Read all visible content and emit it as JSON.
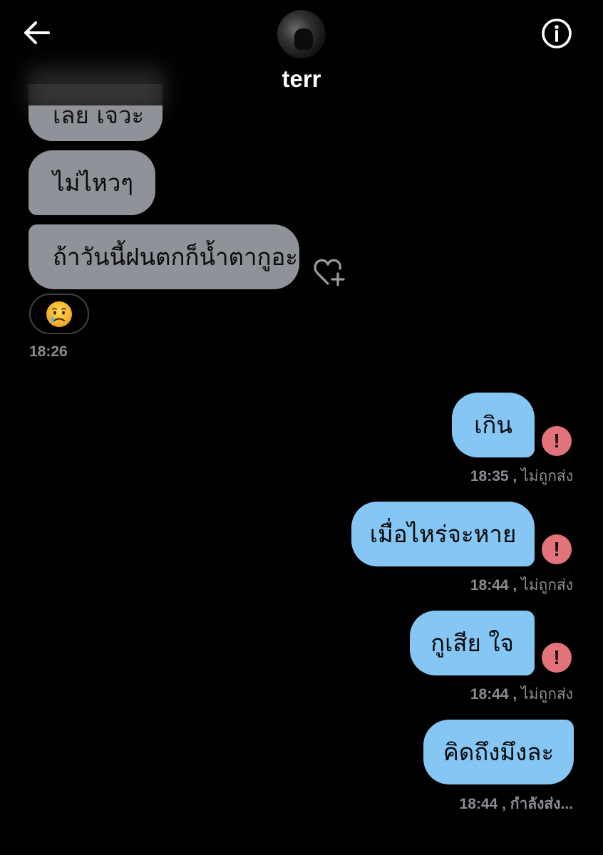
{
  "header": {
    "contact_name": "terr",
    "back_icon": "arrow-left-icon",
    "info_icon": "info-icon"
  },
  "incoming": [
    {
      "text": "เลย เจวะ"
    },
    {
      "text": "ไม่ไหวๆ"
    },
    {
      "text": "ถ้าวันนี้ฝนตกก็น้ำตากูอะ"
    }
  ],
  "reaction": {
    "emoji": "😢"
  },
  "incoming_time": "18:26",
  "outgoing": [
    {
      "text": "เกิน",
      "time": "18:35",
      "status": "ไม่ถูกส่ง"
    },
    {
      "text": "เมื่อไหร่จะหาย",
      "time": "18:44",
      "status": "ไม่ถูกส่ง"
    },
    {
      "text": "กูเสีย ใจ",
      "time": "18:44",
      "status": "ไม่ถูกส่ง"
    },
    {
      "text": "คิดถึงมึงละ",
      "time": "18:44",
      "status": "กำลังส่ง..."
    }
  ],
  "meta_separator": ",",
  "error_mark": "!",
  "colors": {
    "background": "#000000",
    "incoming_bubble": "#8f9298",
    "outgoing_bubble": "#86c6f4",
    "error": "#e2737b",
    "meta_text": "#8a8d92"
  }
}
